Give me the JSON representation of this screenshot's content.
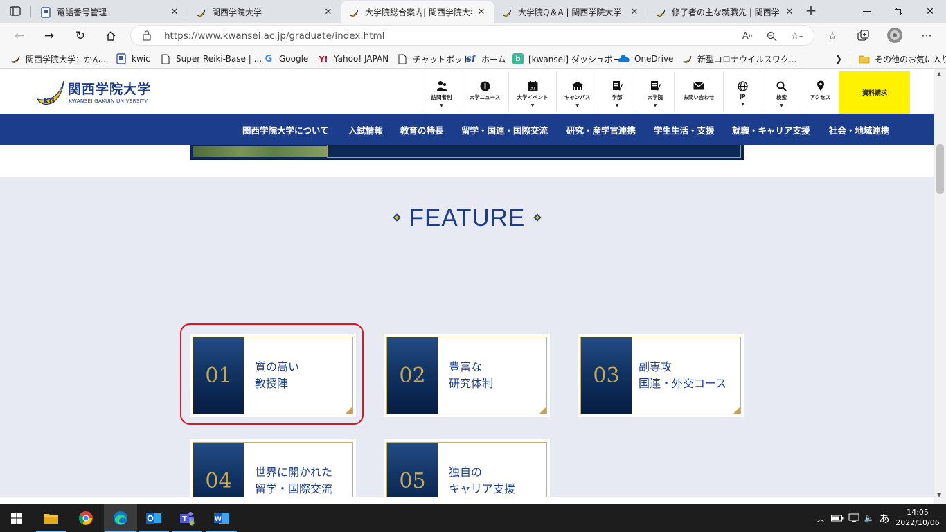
{
  "browser": {
    "tabs": [
      {
        "title": "電話番号管理",
        "active": false
      },
      {
        "title": "関西学院大学",
        "active": false
      },
      {
        "title": "大学院総合案内| 関西学院大学",
        "active": true
      },
      {
        "title": "大学院Q＆A | 関西学院大学",
        "active": false
      },
      {
        "title": "修了者の主な就職先 | 関西学院大学",
        "active": false
      }
    ],
    "new_tab": "+",
    "url": "https://www.kwansei.ac.jp/graduate/index.html",
    "favorites": [
      {
        "label": "関西学院大学：かん...",
        "icon": "moon-icon"
      },
      {
        "label": "kwic",
        "icon": "page-icon"
      },
      {
        "label": "Super Reiki-Base | ...",
        "icon": "doc-icon"
      },
      {
        "label": "Google",
        "icon": "google-icon"
      },
      {
        "label": "Yahoo! JAPAN",
        "icon": "yahoo-icon"
      },
      {
        "label": "チャットボット",
        "icon": "doc-icon"
      },
      {
        "label": "ホーム",
        "icon": "sf-icon"
      },
      {
        "label": "[kwansei] ダッシュボー...",
        "icon": "b-icon"
      },
      {
        "label": "OneDrive",
        "icon": "cloud-icon"
      },
      {
        "label": "新型コロナウイルスワク...",
        "icon": "moon-icon"
      }
    ],
    "other_favorites": "その他のお気に入り"
  },
  "site": {
    "logo_jp": "関西学院大学",
    "logo_en": "KWANSEI GAKUIN UNIVERSITY",
    "utility_nav": [
      {
        "label": "訪問者別",
        "icon": "visitor-icon",
        "has_caret": true
      },
      {
        "label": "大学ニュース",
        "icon": "info-icon",
        "has_caret": false
      },
      {
        "label": "大学イベント",
        "icon": "calendar-icon",
        "has_caret": true
      },
      {
        "label": "キャンパス",
        "icon": "campus-icon",
        "has_caret": true
      },
      {
        "label": "学部",
        "icon": "faculty-icon",
        "has_caret": true
      },
      {
        "label": "大学院",
        "icon": "graduate-icon",
        "has_caret": true
      },
      {
        "label": "お問い合わせ",
        "icon": "mail-icon",
        "has_caret": false
      },
      {
        "label": "JP",
        "icon": "globe-icon",
        "has_caret": true
      },
      {
        "label": "検索",
        "icon": "search-icon",
        "has_caret": true
      },
      {
        "label": "アクセス",
        "icon": "pin-icon",
        "has_caret": false
      }
    ],
    "request_docs": "資料請求",
    "calendar_day": "31",
    "global_nav": [
      "関西学院大学について",
      "入試情報",
      "教育の特長",
      "留学・国連・国際交流",
      "研究・産学官連携",
      "学生生活・支援",
      "就職・キャリア支援",
      "社会・地域連携"
    ],
    "feature": {
      "heading": "FEATURE",
      "cards": [
        {
          "num": "01",
          "line1": "質の高い",
          "line2": "教授陣",
          "highlighted": true
        },
        {
          "num": "02",
          "line1": "豊富な",
          "line2": "研究体制",
          "highlighted": false
        },
        {
          "num": "03",
          "line1": "副専攻",
          "line2": "国連・外交コース",
          "highlighted": false
        },
        {
          "num": "04",
          "line1": "世界に開かれた",
          "line2": "留学・国際交流",
          "highlighted": false
        },
        {
          "num": "05",
          "line1": "独自の",
          "line2": "キャリア支援",
          "highlighted": false
        }
      ]
    }
  },
  "taskbar": {
    "time": "14:05",
    "date": "2022/10/06",
    "ime": "あ"
  },
  "colors": {
    "brand_blue": "#1c3c8c",
    "gold": "#c8a85b",
    "yellow": "#fff200",
    "highlight_red": "#e0141f"
  }
}
